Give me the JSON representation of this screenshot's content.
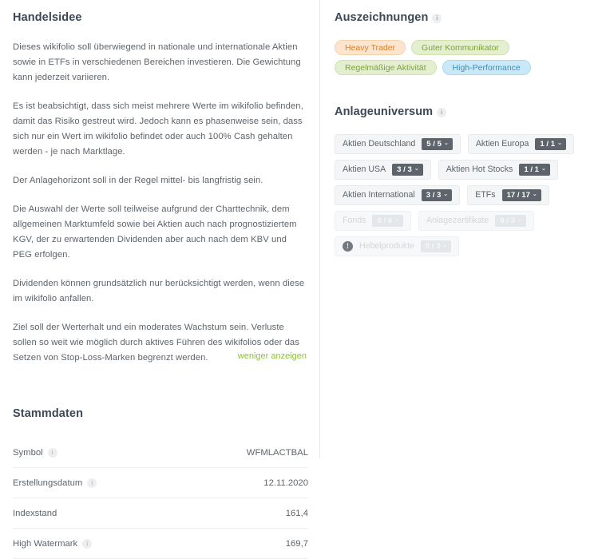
{
  "left": {
    "handelsidee": {
      "title": "Handelsidee",
      "paragraphs": [
        "Dieses wikifolio soll überwiegend in nationale und internationale Aktien sowie in ETFs in verschiedenen Bereichen investieren. Die Gewichtung kann jederzeit variieren.",
        "Es ist beabsichtigt, dass sich meist mehrere Werte im wikifolio befinden, damit das Risiko gestreut wird. Jedoch kann es phasenweise sein, dass sich nur ein Wert im wikifolio befindet oder auch 100% Cash gehalten werden - je nach Marktlage.",
        "Der Anlagehorizont soll in der Regel mittel- bis langfristig sein.",
        "Die Auswahl der Werte soll teilweise aufgrund der Charttechnik, dem allgemeinen Marktumfeld sowie bei Aktien auch nach prognostiziertem KGV, der zu erwartenden Dividenden aber auch nach dem KBV und PEG erfolgen.",
        "Dividenden können grundsätzlich nur berücksichtigt werden, wenn diese im wikifolio anfallen.",
        "Ziel soll der Werterhalt und ein moderates Wachstum sein. Verluste sollen so weit wie möglich durch aktives Führen des wikifolios oder das Setzen von Stop-Loss-Marken begrenzt werden."
      ],
      "collapse_link": "weniger anzeigen"
    },
    "stammdaten": {
      "title": "Stammdaten",
      "rows": [
        {
          "label": "Symbol",
          "info": true,
          "value": "WFMLACTBAL"
        },
        {
          "label": "Erstellungsdatum",
          "info": true,
          "value": "12.11.2020"
        },
        {
          "label": "Indexstand",
          "info": false,
          "value": "161,4"
        },
        {
          "label": "High Watermark",
          "info": true,
          "value": "169,7"
        }
      ]
    }
  },
  "right": {
    "auszeichnungen": {
      "title": "Auszeichnungen",
      "info": true,
      "badges": [
        {
          "label": "Heavy Trader",
          "color": "orange",
          "hex": "#d98127"
        },
        {
          "label": "Guter Kommunikator",
          "color": "green",
          "hex": "#7fa13c"
        },
        {
          "label": "Regelmäßige Aktivität",
          "color": "green",
          "hex": "#7fa13c"
        },
        {
          "label": "High-Performance",
          "color": "blue",
          "hex": "#3592bf"
        }
      ]
    },
    "anlageuniversum": {
      "title": "Anlageuniversum",
      "info": true,
      "items": [
        {
          "label": "Aktien Deutschland",
          "count": "5 / 5",
          "disabled": false,
          "alert": false
        },
        {
          "label": "Aktien Europa",
          "count": "1 / 1",
          "disabled": false,
          "alert": false
        },
        {
          "label": "Aktien USA",
          "count": "3 / 3",
          "disabled": false,
          "alert": false
        },
        {
          "label": "Aktien Hot Stocks",
          "count": "1 / 1",
          "disabled": false,
          "alert": false
        },
        {
          "label": "Aktien International",
          "count": "3 / 3",
          "disabled": false,
          "alert": false
        },
        {
          "label": "ETFs",
          "count": "17 / 17",
          "disabled": false,
          "alert": false
        },
        {
          "label": "Fonds",
          "count": "0 / 6",
          "disabled": true,
          "alert": false
        },
        {
          "label": "Anlagezertifikate",
          "count": "0 / 3",
          "disabled": true,
          "alert": false
        },
        {
          "label": "Hebelprodukte",
          "count": "0 / 3",
          "disabled": true,
          "alert": true
        }
      ]
    }
  },
  "icons": {
    "info_glyph": "i",
    "alert_glyph": "!",
    "chevron_glyph": "⌄"
  }
}
